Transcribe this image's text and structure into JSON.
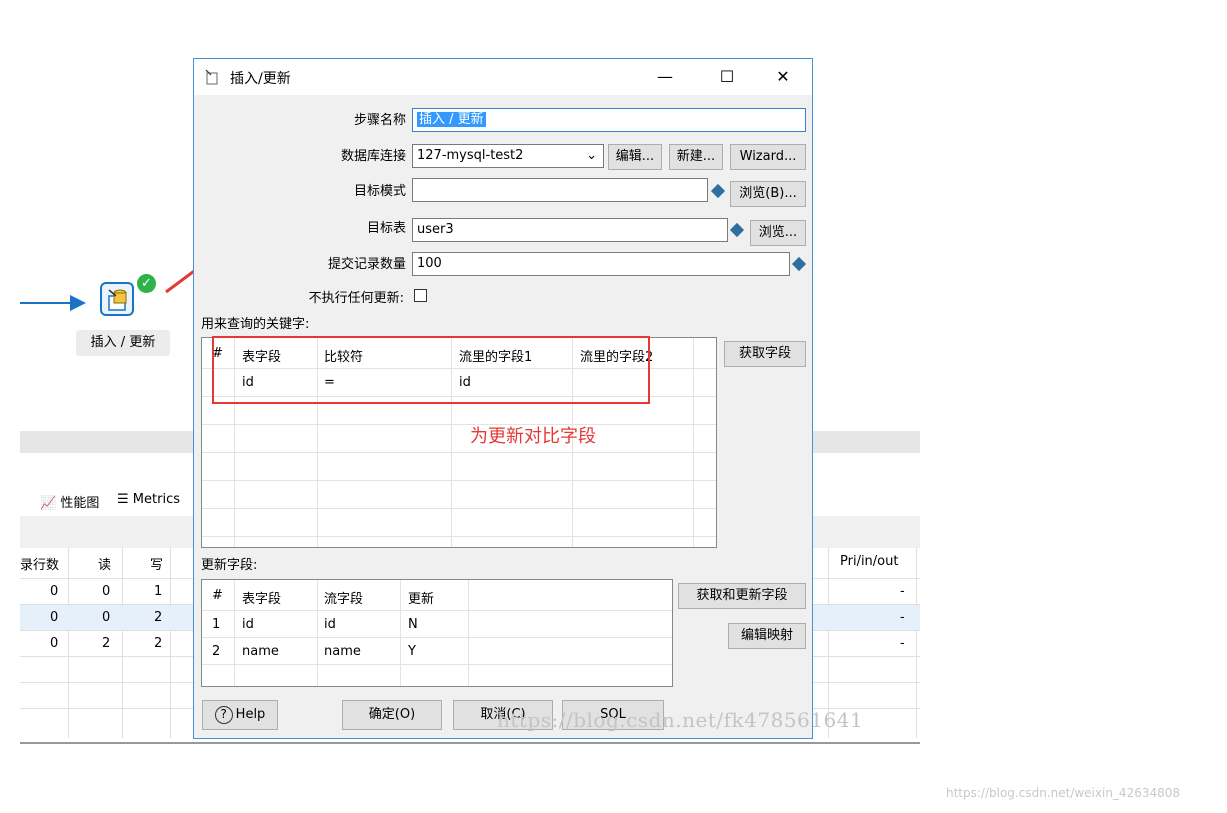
{
  "canvas": {
    "step_label": "插入 / 更新"
  },
  "bg_tabs": [
    "性能图",
    "Metrics"
  ],
  "bg_table": {
    "headers": [
      "录行数",
      "读",
      "写",
      "Pri/in/out"
    ],
    "rows": [
      [
        "0",
        "0",
        "1",
        "-"
      ],
      [
        "0",
        "0",
        "2",
        "-"
      ],
      [
        "0",
        "2",
        "2",
        "-"
      ]
    ]
  },
  "dialog": {
    "title": "插入/更新",
    "window_controls": {
      "minimize": "—",
      "maximize": "☐",
      "close": "✕"
    },
    "fields": {
      "step_name_label": "步骤名称",
      "step_name_value": "插入 / 更新",
      "db_conn_label": "数据库连接",
      "db_conn_value": "127-mysql-test2",
      "edit_button": "编辑...",
      "new_button": "新建...",
      "wizard_button": "Wizard...",
      "target_schema_label": "目标模式",
      "target_schema_value": "",
      "browse_b_button": "浏览(B)...",
      "target_table_label": "目标表",
      "target_table_value": "user3",
      "browse_button": "浏览...",
      "commit_size_label": "提交记录数量",
      "commit_size_value": "100",
      "no_update_label": "不执行任何更新:"
    },
    "key_section": {
      "label": "用来查询的关键字:",
      "columns": [
        "#",
        "表字段",
        "比较符",
        "流里的字段1",
        "流里的字段2"
      ],
      "rows": [
        [
          "",
          "id",
          "=",
          "id",
          ""
        ]
      ],
      "get_fields_button": "获取字段"
    },
    "update_section": {
      "label": "更新字段:",
      "columns": [
        "#",
        "表字段",
        "流字段",
        "更新"
      ],
      "rows": [
        [
          "1",
          "id",
          "id",
          "N"
        ],
        [
          "2",
          "name",
          "name",
          "Y"
        ]
      ],
      "get_update_fields_button": "获取和更新字段",
      "edit_mapping_button": "编辑映射"
    },
    "footer": {
      "help": "Help",
      "ok": "确定(O)",
      "cancel": "取消(C)",
      "sql": "SQL"
    }
  },
  "annotation": {
    "note": "为更新对比字段",
    "color": "#e53935"
  },
  "watermark": "https://blog.csdn.net/fk478561641",
  "page_watermark": "https://blog.csdn.net/weixin_42634808"
}
